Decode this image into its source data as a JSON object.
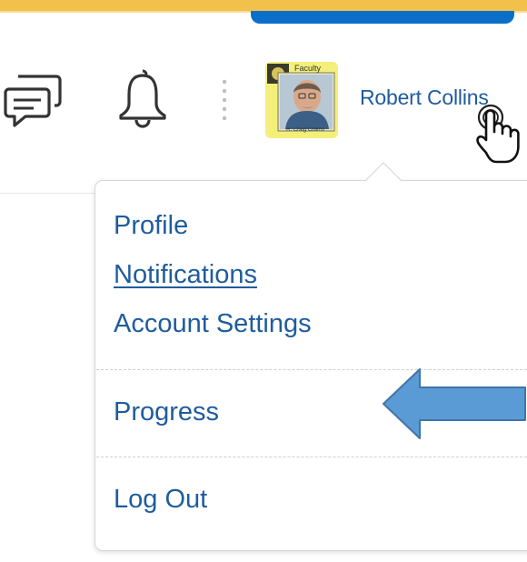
{
  "header": {
    "user_name": "Robert Collins",
    "avatar": {
      "top_label": "Faculty",
      "bottom_label": "R. Craig Collins"
    },
    "icons": [
      "chat-icon",
      "bell-icon",
      "vertical-dots-divider",
      "hand-cursor-icon"
    ],
    "colors": {
      "stripe": "#f2c14b",
      "active_tab": "#0b6fc9",
      "link": "#1f5c9e"
    }
  },
  "user_menu": {
    "items": [
      {
        "label": "Profile"
      },
      {
        "label": "Notifications"
      },
      {
        "label": "Account Settings"
      },
      {
        "label": "Progress"
      },
      {
        "label": "Log Out"
      }
    ],
    "pointer_annotation": "left-pointing-arrow",
    "annotation_color": "#5b9bd5"
  }
}
